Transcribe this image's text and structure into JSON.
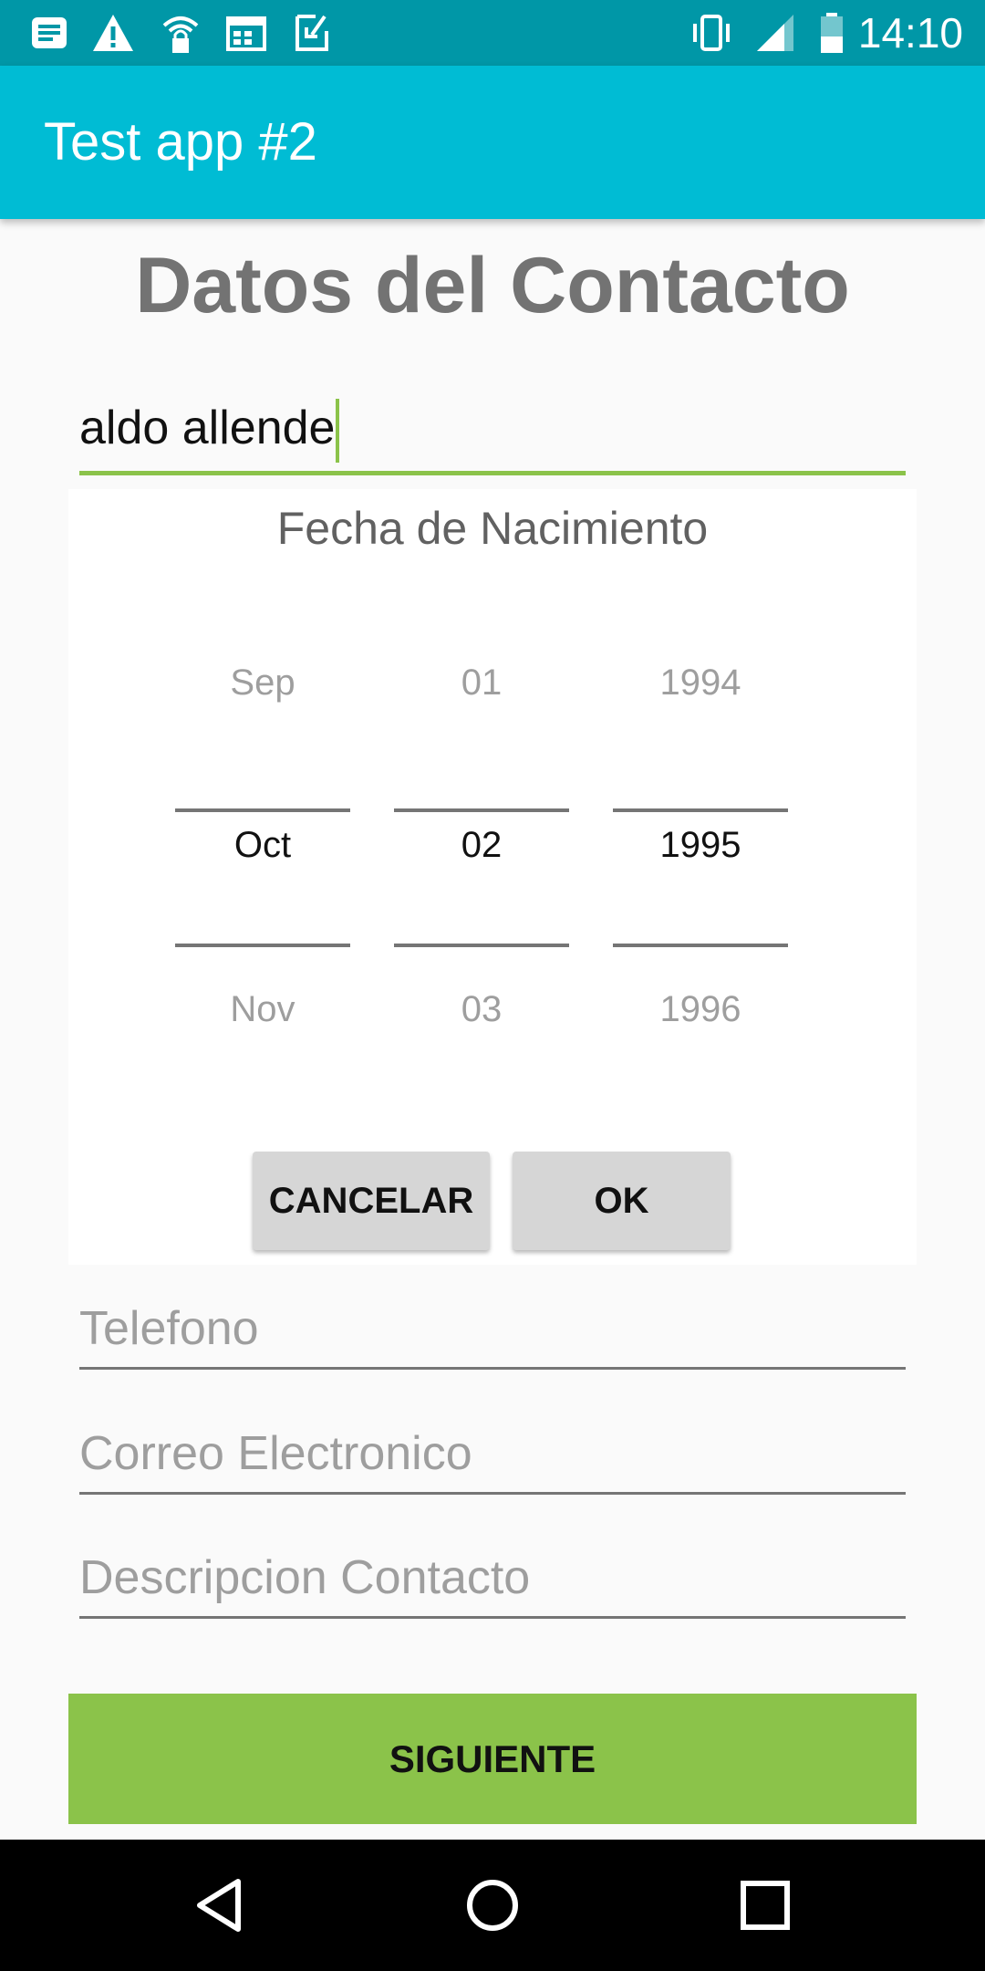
{
  "status_bar": {
    "time": "14:10",
    "icons_left": [
      "notification-icon",
      "warning-icon",
      "wifi-lock-icon",
      "calendar-icon",
      "download-icon"
    ],
    "icons_right": [
      "vibrate-icon",
      "signal-icon",
      "battery-icon"
    ]
  },
  "app_bar": {
    "title": "Test app #2"
  },
  "page": {
    "title": "Datos del Contacto"
  },
  "form": {
    "name_value": "aldo allende",
    "date_picker": {
      "label": "Fecha de Nacimiento",
      "month": {
        "prev": "Sep",
        "current": "Oct",
        "next": "Nov"
      },
      "day": {
        "prev": "01",
        "current": "02",
        "next": "03"
      },
      "year": {
        "prev": "1994",
        "current": "1995",
        "next": "1996"
      },
      "cancel_label": "CANCELAR",
      "ok_label": "OK"
    },
    "phone_placeholder": "Telefono",
    "email_placeholder": "Correo Electronico",
    "description_placeholder": "Descripcion Contacto",
    "next_label": "SIGUIENTE"
  },
  "nav_bar": {
    "icons": [
      "back-icon",
      "home-icon",
      "recents-icon"
    ]
  },
  "colors": {
    "status_bar": "#0097a7",
    "app_bar": "#00bcd4",
    "accent": "#8bc34a"
  }
}
